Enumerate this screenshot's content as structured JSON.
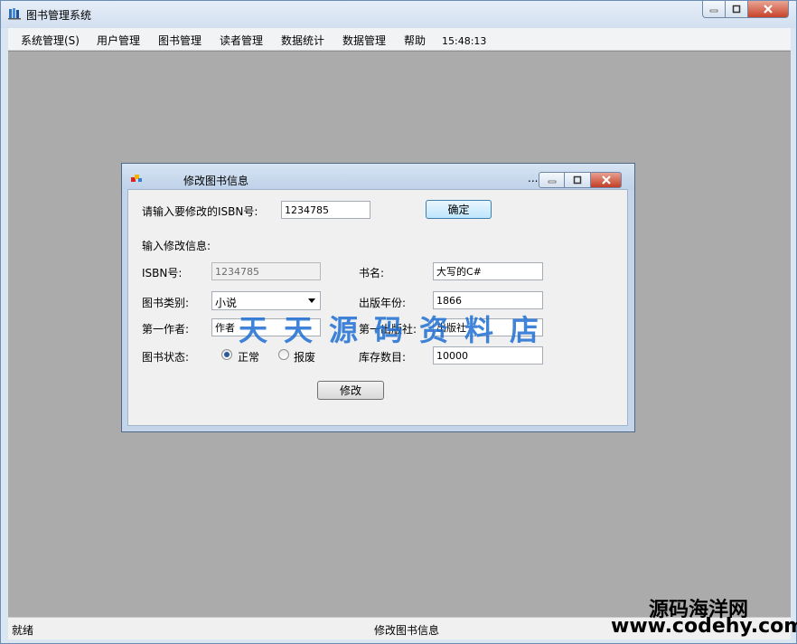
{
  "main_window": {
    "title": "图书管理系统",
    "menu": [
      {
        "label": "系统管理(S)"
      },
      {
        "label": "用户管理"
      },
      {
        "label": "图书管理"
      },
      {
        "label": "读者管理"
      },
      {
        "label": "数据统计"
      },
      {
        "label": "数据管理"
      },
      {
        "label": "帮助"
      }
    ],
    "clock": "15:48:13",
    "status": {
      "left": "就绪",
      "center": "修改图书信息"
    }
  },
  "dialog": {
    "title": "修改图书信息",
    "ellipsis": "...",
    "isbn_prompt": "请输入要修改的ISBN号:",
    "isbn_query_value": "1234785",
    "confirm_label": "确定",
    "section_label": "输入修改信息:",
    "fields": {
      "isbn": {
        "label": "ISBN号:",
        "value": "1234785"
      },
      "title": {
        "label": "书名:",
        "value": "大写的C#"
      },
      "category": {
        "label": "图书类别:",
        "value": "小说"
      },
      "year": {
        "label": "出版年份:",
        "value": "1866"
      },
      "author": {
        "label": "第一作者:",
        "value": "作者"
      },
      "publisher": {
        "label": "第一出版社:",
        "value": "出版社"
      },
      "status": {
        "label": "图书状态:",
        "options": [
          "正常",
          "报废"
        ],
        "selected": "正常"
      },
      "stock": {
        "label": "库存数目:",
        "value": "10000"
      }
    },
    "submit_label": "修改"
  },
  "watermarks": {
    "overlay": "天天源码资料店",
    "site_name": "源码海洋网",
    "site_url": "www.codehy.com"
  },
  "colors": {
    "mdi_background": "#ababab",
    "watermark": "#1f6fd4",
    "close_button": "#c7432a"
  }
}
